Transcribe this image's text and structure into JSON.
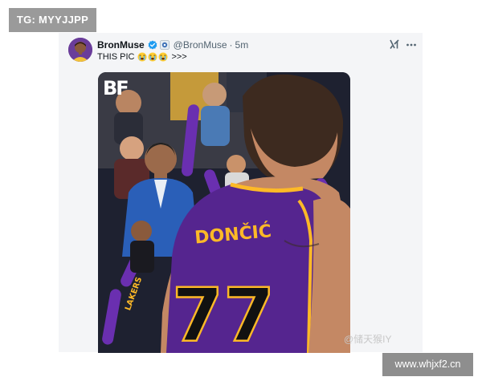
{
  "watermarks": {
    "top_left": "TG: MYYJJPP",
    "bottom_right": "www.whjxf2.cn",
    "weibo": "@储天猴IY"
  },
  "tweet": {
    "display_name": "BronMuse",
    "handle": "@BronMuse",
    "separator": "·",
    "time": "5m",
    "text": "THIS PIC",
    "text_tail": ">>>",
    "emojis": [
      "crying-face",
      "crying-face",
      "crying-face"
    ],
    "media": {
      "logo": "BF",
      "jersey_name": "DONČIĆ",
      "jersey_number": "77",
      "thunder_stick_label": "LAKERS"
    }
  },
  "icons": {
    "verified": "verified-badge-icon",
    "affiliation": "affiliation-badge-icon",
    "grok": "grok-icon",
    "more": "more-options-icon"
  },
  "colors": {
    "verified_blue": "#1d9bf0",
    "lakers_purple": "#55258f",
    "lakers_gold": "#fdb927",
    "card_bg": "#f4f5f7"
  }
}
